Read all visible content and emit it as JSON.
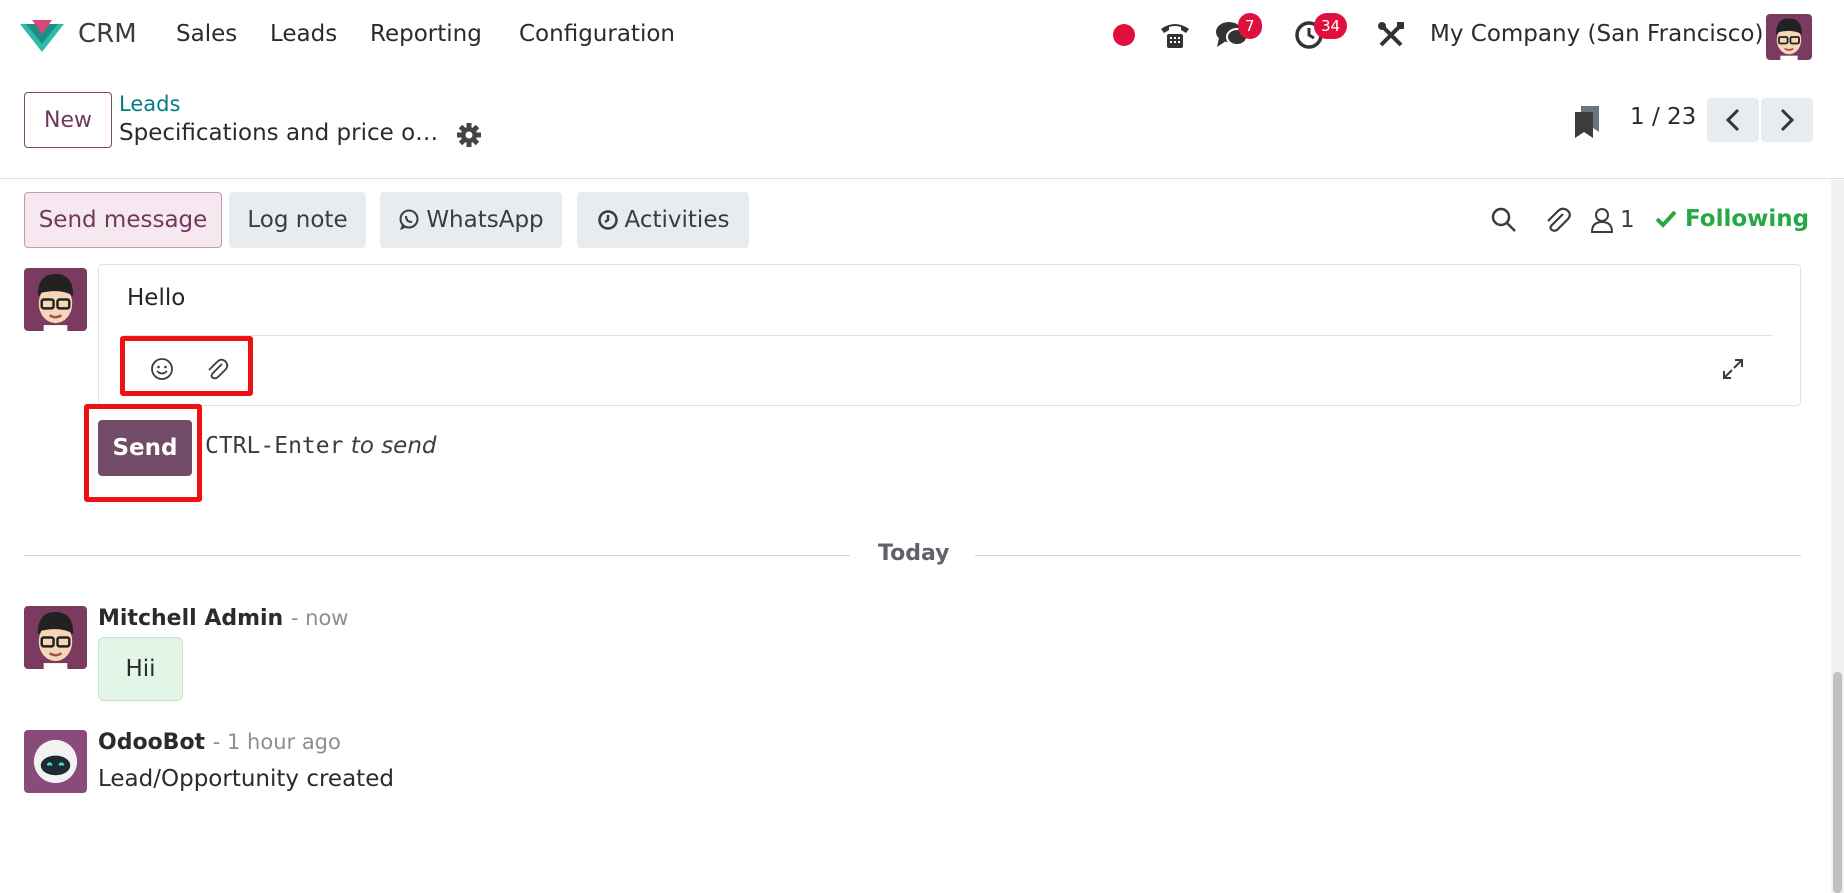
{
  "navbar": {
    "app_name": "CRM",
    "menu": [
      "Sales",
      "Leads",
      "Reporting",
      "Configuration"
    ],
    "icons": [
      "record-dot-icon",
      "phone-icon",
      "chat-icon",
      "clock-icon",
      "tools-icon"
    ],
    "messages_badge": "7",
    "activities_badge": "34",
    "company": "My Company (San Francisco)"
  },
  "control_panel": {
    "new_label": "New",
    "breadcrumb_link": "Leads",
    "record_title": "Specifications and price of …",
    "pager": "1 / 23"
  },
  "chatter": {
    "buttons": {
      "send_message": "Send message",
      "log_note": "Log note",
      "whatsapp": "WhatsApp",
      "activities": "Activities"
    },
    "followers_count": "1",
    "following_label": "Following",
    "composer_text": "Hello",
    "send_label": "Send",
    "hint_key": "CTRL-Enter",
    "hint_text": "to send",
    "date_separator": "Today",
    "messages": [
      {
        "author": "Mitchell Admin",
        "time": "- now",
        "body": "Hii"
      },
      {
        "author": "OdooBot",
        "time": "- 1 hour ago",
        "body": "Lead/Opportunity created"
      }
    ]
  },
  "colors": {
    "primary": "#714b67",
    "link": "#017e84",
    "badge": "#e0103e",
    "following": "#28a745",
    "highlight": "#ee1111"
  }
}
